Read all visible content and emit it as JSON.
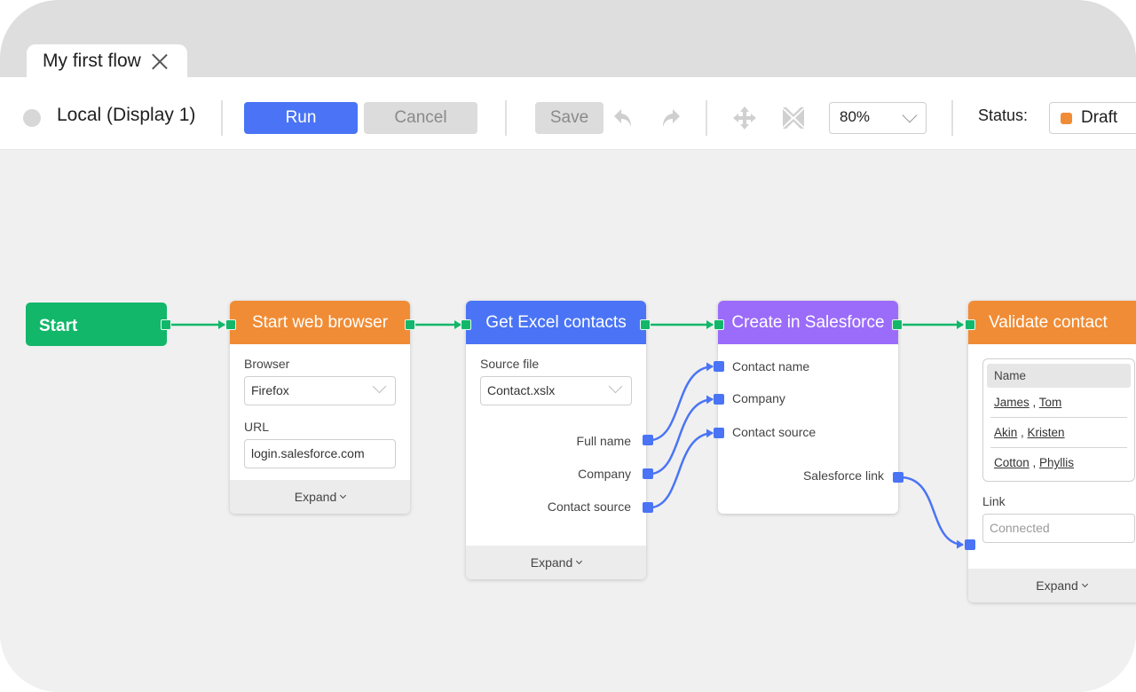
{
  "tab": {
    "title": "My first flow"
  },
  "toolbar": {
    "environment": "Local (Display 1)",
    "run_label": "Run",
    "cancel_label": "Cancel",
    "save_label": "Save",
    "zoom_value": "80%",
    "status_label": "Status:",
    "status_value": "Draft"
  },
  "colors": {
    "accent_blue": "#4a74f5",
    "start_green": "#12b76a",
    "orange": "#f08c35",
    "purple": "#9b6cfa",
    "draft_swatch": "#f08c35"
  },
  "nodes": {
    "start": {
      "label": "Start"
    },
    "browser": {
      "title": "Start web browser",
      "browser_label": "Browser",
      "browser_value": "Firefox",
      "url_label": "URL",
      "url_value": "login.salesforce.com",
      "expand": "Expand"
    },
    "excel": {
      "title": "Get Excel contacts",
      "source_label": "Source file",
      "source_value": "Contact.xslx",
      "outputs": [
        "Full name",
        "Company",
        "Contact source"
      ],
      "expand": "Expand"
    },
    "salesforce": {
      "title": "Create in Salesforce",
      "inputs": [
        "Contact name",
        "Company",
        "Contact source"
      ],
      "output": "Salesforce link"
    },
    "validate": {
      "title": "Validate contact",
      "table_header": "Name",
      "rows": [
        {
          "last": "James",
          "first": "Tom"
        },
        {
          "last": "Akin",
          "first": "Kristen"
        },
        {
          "last": "Cotton",
          "first": "Phyllis"
        }
      ],
      "link_label": "Link",
      "link_placeholder": "Connected",
      "expand": "Expand"
    }
  }
}
